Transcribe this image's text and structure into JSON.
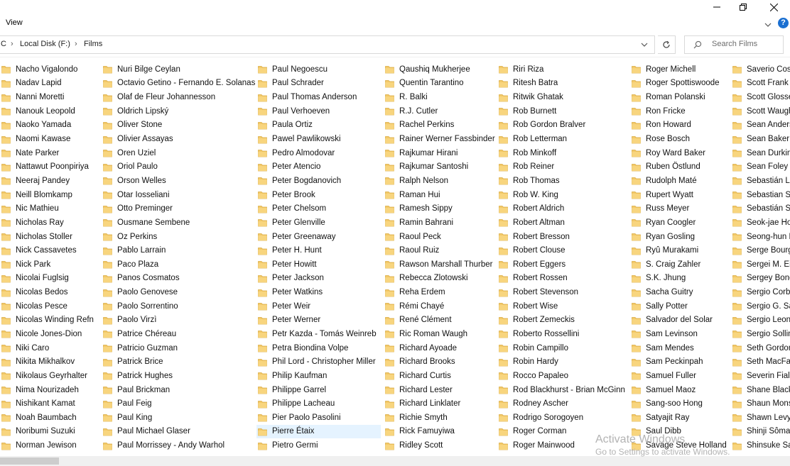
{
  "ribbon": {
    "view_label": "View"
  },
  "address": {
    "path": [
      "C",
      "Local Disk (F:)",
      "Films"
    ]
  },
  "search": {
    "placeholder": "Search Films"
  },
  "columns": [
    [
      "Nacho Vigalondo",
      "Nadav Lapid",
      "Nanni Moretti",
      "Nanouk Leopold",
      "Naoko Yamada",
      "Naomi Kawase",
      "Nate Parker",
      "Nattawut Poonpiriya",
      "Neeraj Pandey",
      "Neill Blomkamp",
      "Nic Mathieu",
      "Nicholas Ray",
      "Nicholas Stoller",
      "Nick Cassavetes",
      "Nick Park",
      "Nicolai Fuglsig",
      "Nicolas Bedos",
      "Nicolas Pesce",
      "Nicolas Winding Refn",
      "Nicole Jones-Dion",
      "Niki Caro",
      "Nikita Mikhalkov",
      "Nikolaus Geyrhalter",
      "Nima Nourizadeh",
      "Nishikant Kamat",
      "Noah Baumbach",
      "Noribumi Suzuki",
      "Norman Jewison"
    ],
    [
      "Nuri Bilge Ceylan",
      "Octavio Getino - Fernando E. Solanas",
      "Olaf de Fleur Johannesson",
      "Oldrich Lipský",
      "Oliver Stone",
      "Olivier Assayas",
      "Oren Uziel",
      "Oriol Paulo",
      "Orson Welles",
      "Otar Iosseliani",
      "Otto Preminger",
      "Ousmane Sembene",
      "Oz Perkins",
      "Pablo Larrain",
      "Paco Plaza",
      "Panos Cosmatos",
      "Paolo Genovese",
      "Paolo Sorrentino",
      "Paolo Virzì",
      "Patrice Chéreau",
      "Patricio Guzman",
      "Patrick Brice",
      "Patrick Hughes",
      "Paul Brickman",
      "Paul Feig",
      "Paul King",
      "Paul Michael Glaser",
      "Paul Morrissey - Andy Warhol"
    ],
    [
      "Paul Negoescu",
      "Paul Schrader",
      "Paul Thomas Anderson",
      "Paul Verhoeven",
      "Paula Ortiz",
      "Pawel Pawlikowski",
      "Pedro Almodovar",
      "Peter Atencio",
      "Peter Bogdanovich",
      "Peter Brook",
      "Peter Chelsom",
      "Peter Glenville",
      "Peter Greenaway",
      "Peter H. Hunt",
      "Peter Howitt",
      "Peter Jackson",
      "Peter Watkins",
      "Peter Weir",
      "Peter Werner",
      "Petr Kazda - Tomás Weinreb",
      "Petra Biondina Volpe",
      "Phil Lord - Christopher Miller",
      "Philip Kaufman",
      "Philippe Garrel",
      "Philippe Lacheau",
      "Pier Paolo Pasolini",
      "Pierre Étaix",
      "Pietro Germi"
    ],
    [
      "Qaushiq Mukherjee",
      "Quentin Tarantino",
      "R. Balki",
      "R.J. Cutler",
      "Rachel Perkins",
      "Rainer Werner Fassbinder",
      "Rajkumar Hirani",
      "Rajkumar Santoshi",
      "Ralph Nelson",
      "Raman Hui",
      "Ramesh Sippy",
      "Ramin Bahrani",
      "Raoul Peck",
      "Raoul Ruiz",
      "Rawson Marshall Thurber",
      "Rebecca Zlotowski",
      "Reha Erdem",
      "Rémi Chayé",
      "René Clément",
      "Ric Roman Waugh",
      "Richard Ayoade",
      "Richard Brooks",
      "Richard Curtis",
      "Richard Lester",
      "Richard Linklater",
      "Richie Smyth",
      "Rick Famuyiwa",
      "Ridley Scott"
    ],
    [
      "Riri Riza",
      "Ritesh Batra",
      "Ritwik Ghatak",
      "Rob Burnett",
      "Rob Gordon Bralver",
      "Rob Letterman",
      "Rob Minkoff",
      "Rob Reiner",
      "Rob Thomas",
      "Rob W. King",
      "Robert Aldrich",
      "Robert Altman",
      "Robert Bresson",
      "Robert Clouse",
      "Robert Eggers",
      "Robert Rossen",
      "Robert Stevenson",
      "Robert Wise",
      "Robert Zemeckis",
      "Roberto Rossellini",
      "Robin Campillo",
      "Robin Hardy",
      "Rocco Papaleo",
      "Rod Blackhurst - Brian McGinn",
      "Rodney Ascher",
      "Rodrigo Sorogoyen",
      "Roger Corman",
      "Roger Mainwood"
    ],
    [
      "Roger Michell",
      "Roger Spottiswoode",
      "Roman Polanski",
      "Ron Fricke",
      "Ron Howard",
      "Rose Bosch",
      "Roy Ward Baker",
      "Ruben Östlund",
      "Rudolph Maté",
      "Rupert Wyatt",
      "Russ Meyer",
      "Ryan Coogler",
      "Ryan Gosling",
      "Ryû Murakami",
      "S. Craig Zahler",
      "S.K. Jhung",
      "Sacha Guitry",
      "Sally Potter",
      "Salvador del Solar",
      "Sam Levinson",
      "Sam Mendes",
      "Sam Peckinpah",
      "Samuel Fuller",
      "Samuel Maoz",
      "Sang-soo Hong",
      "Satyajit Ray",
      "Saul Dibb",
      "Savage Steve Holland"
    ],
    [
      "Saverio Costa",
      "Scott Frank",
      "Scott Glosserm",
      "Scott Waugh",
      "Sean Anders",
      "Sean Baker",
      "Sean Durkin",
      "Sean Foley",
      "Sebastián Leli",
      "Sebastian Sch",
      "Sebastián Silv",
      "Seok-jae Hon",
      "Seong-hun Ki",
      "Serge Bourgu",
      "Sergei M. Eise",
      "Sergey Bonda",
      "Sergio Corbu",
      "Sergio G. Sán",
      "Sergio Leone",
      "Sergio Sollim",
      "Seth Gordon",
      "Seth MacFarla",
      "Severin Fiala -",
      "Shane Black",
      "Shaun Monso",
      "Shawn Levy",
      "Shinji Sômai",
      "Shinsuke Sato"
    ]
  ],
  "selected_item": "Pierre Étaix",
  "watermark": {
    "line1": "Activate Windows",
    "line2": "Go to Settings to activate Windows."
  },
  "colors": {
    "folder": "#f3c969",
    "selection": "#e5f3ff",
    "help": "#1a6fd1"
  }
}
